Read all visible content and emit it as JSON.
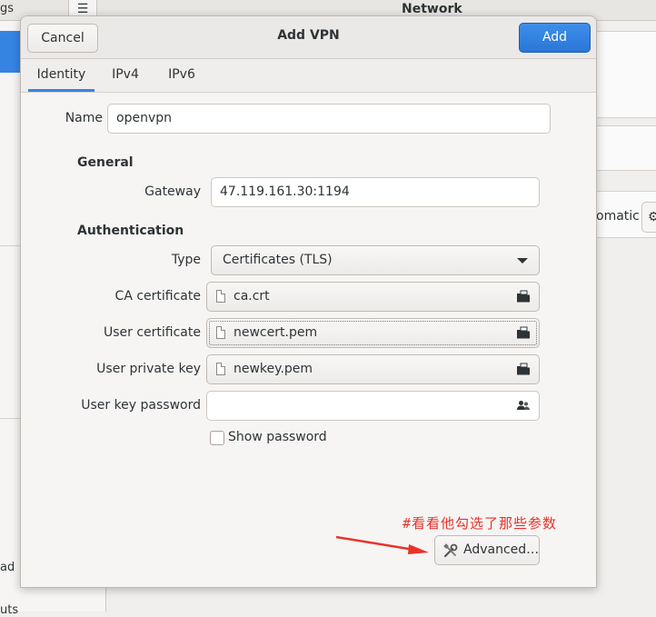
{
  "background": {
    "left_fragment_top": "gs",
    "left_fragment_mid": "ad",
    "left_fragment_bottom": "uts",
    "header_title": "Network",
    "right_fragment": "omatic"
  },
  "dialog": {
    "title": "Add VPN",
    "cancel_label": "Cancel",
    "add_label": "Add",
    "tabs": [
      {
        "label": "Identity",
        "active": true
      },
      {
        "label": "IPv4",
        "active": false
      },
      {
        "label": "IPv6",
        "active": false
      }
    ],
    "name_label": "Name",
    "name_value": "openvpn",
    "general_heading": "General",
    "gateway_label": "Gateway",
    "gateway_value": "47.119.161.30:1194",
    "auth_heading": "Authentication",
    "type_label": "Type",
    "type_value": "Certificates (TLS)",
    "ca_label": "CA certificate",
    "ca_value": "ca.crt",
    "user_cert_label": "User certificate",
    "user_cert_value": "newcert.pem",
    "user_key_label": "User private key",
    "user_key_value": "newkey.pem",
    "key_pwd_label": "User key password",
    "key_pwd_value": "",
    "show_password_label": "Show password",
    "show_password_checked": false,
    "advanced_label": "Advanced…"
  },
  "annotation": {
    "text": "#看看他勾选了那些参数",
    "color": "#e8332a"
  },
  "colors": {
    "accent": "#3584e4"
  },
  "icons": [
    "menu-icon",
    "gear-icon",
    "document-icon",
    "open-file-icon",
    "password-icon",
    "tools-icon",
    "arrow"
  ]
}
